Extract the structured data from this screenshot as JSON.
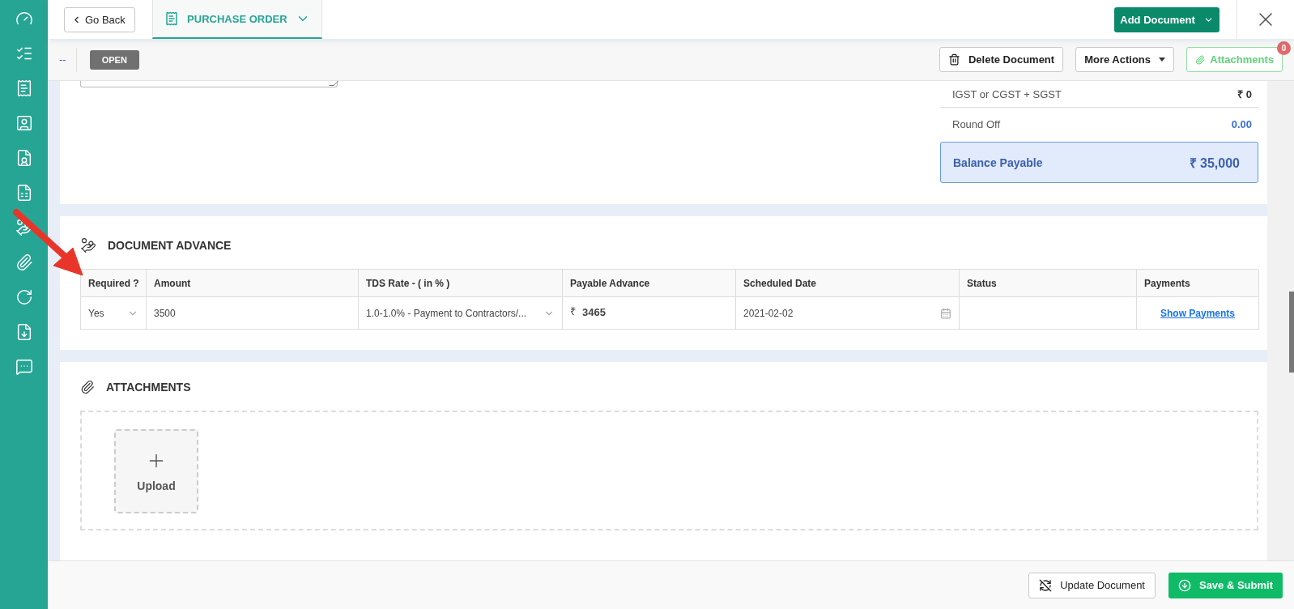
{
  "header": {
    "back_button": "Go Back",
    "document_tab": {
      "label": "PURCHASE ORDER",
      "selected": true
    },
    "add_button": "Add Document"
  },
  "toolbar": {
    "doc_number": "--",
    "status": "OPEN",
    "delete_button": "Delete Document",
    "more_button": "More Actions",
    "attachments_button": "Attachments",
    "attachments_count": "0"
  },
  "summary": {
    "rows": [
      {
        "label": "IGST or CGST + SGST",
        "value": "₹ 0",
        "kind": "plain"
      },
      {
        "label": "Round Off",
        "value": "0.00",
        "kind": "accent"
      }
    ],
    "balance": {
      "label": "Balance Payable",
      "value": "₹ 35,000"
    }
  },
  "advance": {
    "title": "DOCUMENT ADVANCE",
    "columns": [
      "Required ?",
      "Amount",
      "TDS Rate - ( in % )",
      "Payable Advance",
      "Scheduled Date",
      "Status",
      "Payments"
    ],
    "rows": [
      {
        "required": "Yes",
        "amount": "3500",
        "tds_rate": "1.0-1.0% - Payment to Contractors/...",
        "currency": "₹",
        "payable_advance": "3465",
        "scheduled_date": "2021-02-02",
        "payments_link": "Show Payments"
      }
    ]
  },
  "attachments": {
    "title": "ATTACHMENTS",
    "upload_label": "Upload"
  },
  "footer": {
    "update_button": "Update Document",
    "submit_button": "Save & Submit"
  }
}
